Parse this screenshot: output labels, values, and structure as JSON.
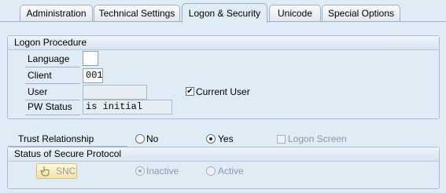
{
  "tabs": [
    {
      "label": "Administration",
      "active": false
    },
    {
      "label": "Technical Settings",
      "active": false
    },
    {
      "label": "Logon & Security",
      "active": true
    },
    {
      "label": "Unicode",
      "active": false
    },
    {
      "label": "Special Options",
      "active": false
    }
  ],
  "logon_procedure": {
    "title": "Logon Procedure",
    "language": {
      "label": "Language",
      "value": ""
    },
    "client": {
      "label": "Client",
      "value": "001"
    },
    "user": {
      "label": "User",
      "value": ""
    },
    "current_user": {
      "label": "Current User",
      "checked": true
    },
    "pw_status": {
      "label": "PW Status",
      "value": "is initial"
    }
  },
  "trust": {
    "label": "Trust Relationship",
    "no_label": "No",
    "yes_label": "Yes",
    "selected": "Yes",
    "logon_screen_label": "Logon Screen",
    "logon_screen_checked": false
  },
  "secure_protocol": {
    "title": "Status of Secure Protocol",
    "snc_label": "SNC",
    "inactive_label": "Inactive",
    "active_label": "Active",
    "selected": "Inactive"
  },
  "colors": {
    "background": "#dfebf5",
    "border": "#9fb0c2",
    "snc_button": "#f3e3a8"
  }
}
